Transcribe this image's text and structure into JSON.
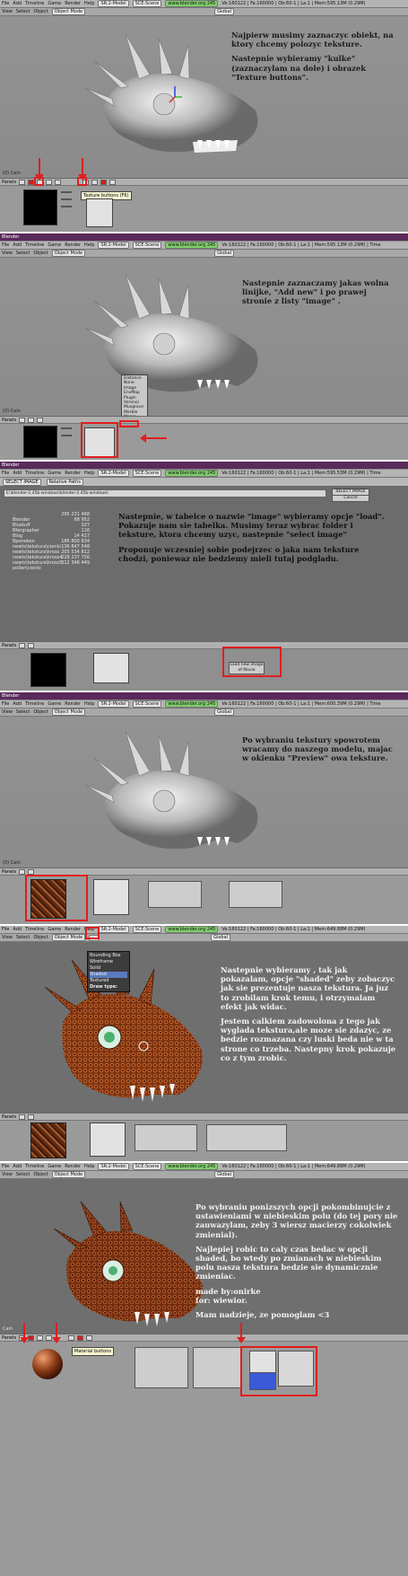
{
  "frame1": {
    "menu": [
      "File",
      "Add",
      "Timeline",
      "Game",
      "Render",
      "Help"
    ],
    "scene_model": "SR:2-Model",
    "scene": "SCE:Scene",
    "site": "www.blender.org 245",
    "stats": "Ve:160122 | Fa:160000 | Ob:60-1 | La:1 | Mem:595.13M (0.29M)",
    "view_items": [
      "View",
      "Select",
      "Object"
    ],
    "mode": "Object Mode",
    "global": "Global",
    "camera_label": "(0) Cain",
    "panels_label": "Panels",
    "tooltip": "Texture buttons (F6)",
    "note": "Najpierw musimy zaznaczyc obiekt, na ktory chcemy polozyc teksture.",
    "note2": "Nastepnie wybieramy \"kulke\" (zaznaczylam na dole) i obrazek \"Texture buttons\"."
  },
  "frame2": {
    "menu": [
      "File",
      "Add",
      "Timeline",
      "Game",
      "Render",
      "Help"
    ],
    "app_label": "Blender",
    "scene_model": "SR:2-Model",
    "scene": "SCE:Scene",
    "site": "www.blender.org 245",
    "stats": "Ve:160122 | Fa:160000 | Ob:60-1 | La:1 | Mem:595.13M (0.29M) | Time",
    "view_items": [
      "View",
      "Select",
      "Object"
    ],
    "mode": "Object Mode",
    "global": "Global",
    "camera_label": "(0) Cain",
    "panels_label": "Panels",
    "list_items": [
      "Distance",
      "None",
      "Image",
      "EnvMap",
      "Plugin",
      "Voronoi",
      "Musgrave",
      "Marble",
      "Magic",
      "Noise",
      "Wood",
      "Clouds",
      "Blend",
      "Stucci"
    ],
    "note": "Nastepnie zaznaczamy jakas wolna linijke, \"Add new\" i po prawej stronie z listy \"image\" ."
  },
  "frame3": {
    "app_label": "Blender",
    "menu": [
      "File",
      "Add",
      "Timeline",
      "Game",
      "Render",
      "Help"
    ],
    "scene_model": "SR:2-Model",
    "scene": "SCE:Scene",
    "site": "www.blender.org 245",
    "stats": "Ve:160122 | Fa:160000 | Ob:60-1 | La:1 | Mem:595.53M (0.29M) | Time",
    "file_mode": "SELECT IMAGE",
    "relative": "Relative Paths",
    "path": "E:\\blender-2.45b-windows\\blender-2.45b-windows\\",
    "select_btn": "SELECT IMAGE",
    "cancel_btn": "Cancel",
    "files": [
      "..",
      "Blender",
      "Bluetuff",
      "Bfergrapher",
      "Blog",
      "Bpeneken",
      "newts\\tekstura\\cienki",
      "newts\\tekstura\\kross",
      "newts\\tekstura\\kross4",
      "newts\\tekstura\\kross5",
      "pollen\\cienki"
    ],
    "sizes": [
      "",
      "295 231 468",
      "68 952",
      "327",
      "116",
      "14 427",
      "186 800 834",
      "136 847 548",
      "205 534 812",
      "228 237 756",
      "312 348 449"
    ],
    "note": "Nastepnie, w tabelce o nazwie \"image\" wybieramy opcje \"load\". Pokazuje nam sie tabelka. Musimy teraz wybrac folder i teksture, ktora chcemy uzyc, nastepnie \"select image\"",
    "note2": "Proponuje wczesniej sobie podejrzec o jaka nam teksture chodzi, poniewaz nie bedziemy mieli tutaj podgladu.",
    "panels_label": "Panels",
    "load_tip": "Load new image of Movie"
  },
  "frame4": {
    "app_label": "Blender",
    "menu": [
      "File",
      "Add",
      "Timeline",
      "Game",
      "Render",
      "Help"
    ],
    "scene_model": "SR:2-Model",
    "scene": "SCE:Scene",
    "site": "www.blender.org 245",
    "stats": "Ve:160122 | Fa:160000 | Ob:60-1 | La:1 | Mem:600.39M (0.29M) | Time",
    "view_items": [
      "View",
      "Select",
      "Object"
    ],
    "mode": "Object Mode",
    "global": "Global",
    "camera_label": "(0) Cain",
    "panels_label": "Panels",
    "note": "Po wybraniu tekstury spowrotem wracamy do naszego modelu, majac w okienku \"Preview\" owa teksture."
  },
  "frame5": {
    "menu": [
      "File",
      "Add",
      "Timeline",
      "Game",
      "Render",
      "Help"
    ],
    "scene_model": "SR:2-Model",
    "scene": "SCE:Scene",
    "site": "www.blender.org 245",
    "stats": "Ve:160122 | Fa:160000 | Ob:60-1 | La:1 | Mem:649.88M (0.29M)",
    "view_items": [
      "View",
      "Select",
      "Object"
    ],
    "mode": "Object Mode",
    "global": "Global",
    "draw_menu": [
      "Bounding Box",
      "Wireframe",
      "Solid",
      "Shaded",
      "Textured"
    ],
    "draw_type_label": "Draw type:",
    "panels_label": "Panels",
    "note": "Nastepnie wybieramy , tak jak pokazalam, opcje \"shaded\" zeby zobaczyc jak sie prezentuje nasza tekstura. Ja juz to zrobilam krok temu, i otrzymalam efekt jak widac.",
    "note2": "Jestem calkiem zadowolona z tego jak wyglada tekstura,ale moze sie zdazyc, ze bedzie rozmazana czy luski beda nie w ta strone co trzeba. Nastepny krok pokazuje co z tym zrobic."
  },
  "frame6": {
    "menu": [
      "File",
      "Add",
      "Timeline",
      "Game",
      "Render",
      "Help"
    ],
    "scene_model": "SR:2-Model",
    "scene": "SCE:Scene",
    "site": "www.blender.org 245",
    "stats": "Ve:160122 | Fa:160000 | Ob:60-1 | La:1 | Mem:649.88M (0.29M)",
    "view_items": [
      "View",
      "Select",
      "Object"
    ],
    "mode": "Object Mode",
    "global": "Global",
    "camera_label": "Cain",
    "panels_label": "Panels",
    "tooltip": "Material buttons",
    "note": "Po wybraniu ponizszych opcji pokombinujcie z ustawieniami w niebieskim polu (do tej pory nie zauwazylam, zeby 3 wiersz macierzy cokolwiek zmienial).",
    "note2": "Najlepiej robic to caly czas bedac w opcji shaded, bo wtedy po zmianach w niebieskim polu nasza tekstura bedzie sie dynamicznie zmieniac.",
    "credit1": "made by:onirke",
    "credit2": "for: wiewior.",
    "closing": "Mam nadzieje, ze pomoglam <3"
  }
}
